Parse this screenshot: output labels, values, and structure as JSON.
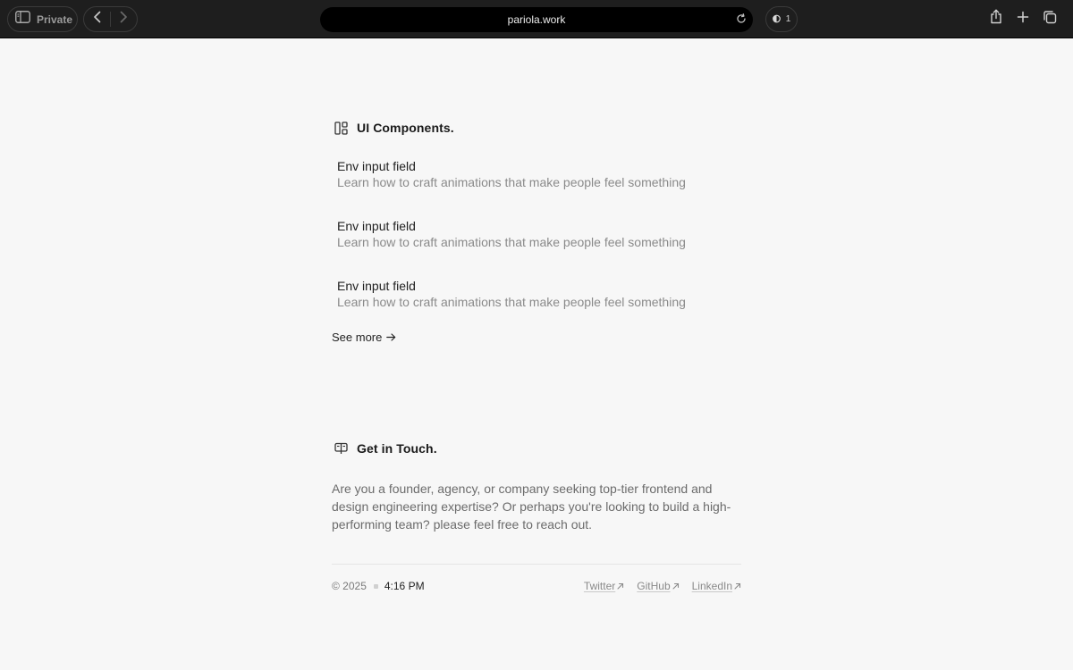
{
  "browser": {
    "private_label": "Private",
    "url": "pariola.work",
    "shield_count": "1",
    "icons": {
      "sidebar": "sidebar-icon",
      "back": "chevron-left-icon",
      "forward": "chevron-right-icon",
      "reload": "reload-icon",
      "shield": "shield-icon",
      "share": "share-icon",
      "new_tab": "plus-icon",
      "tabs": "tabs-icon"
    }
  },
  "components": {
    "title": "UI Components.",
    "icon": "layout-icon",
    "items": [
      {
        "name": "Env input field",
        "description": "Learn how to craft animations that make people feel something"
      },
      {
        "name": "Env input field",
        "description": "Learn how to craft animations that make people feel something"
      },
      {
        "name": "Env input field",
        "description": "Learn how to craft animations that make people feel something"
      }
    ],
    "see_more": "See more",
    "see_more_icon": "arrow-right-icon"
  },
  "contact": {
    "title": "Get in Touch.",
    "icon": "book-open-icon",
    "text": "Are you a founder, agency, or company seeking top-tier frontend and design engineering expertise? Or perhaps you're looking to build a high-performing team? please feel free to reach out."
  },
  "footer": {
    "copyright": "© 2025",
    "time": "4:16 PM",
    "links": [
      {
        "label": "Twitter",
        "icon": "arrow-up-right-icon"
      },
      {
        "label": "GitHub",
        "icon": "arrow-up-right-icon"
      },
      {
        "label": "LinkedIn",
        "icon": "arrow-up-right-icon"
      }
    ]
  },
  "colors": {
    "chrome_bg": "#1e1e1e",
    "page_bg": "#f7f7f7",
    "text_primary": "#222222",
    "text_muted": "#8a8a8a"
  }
}
